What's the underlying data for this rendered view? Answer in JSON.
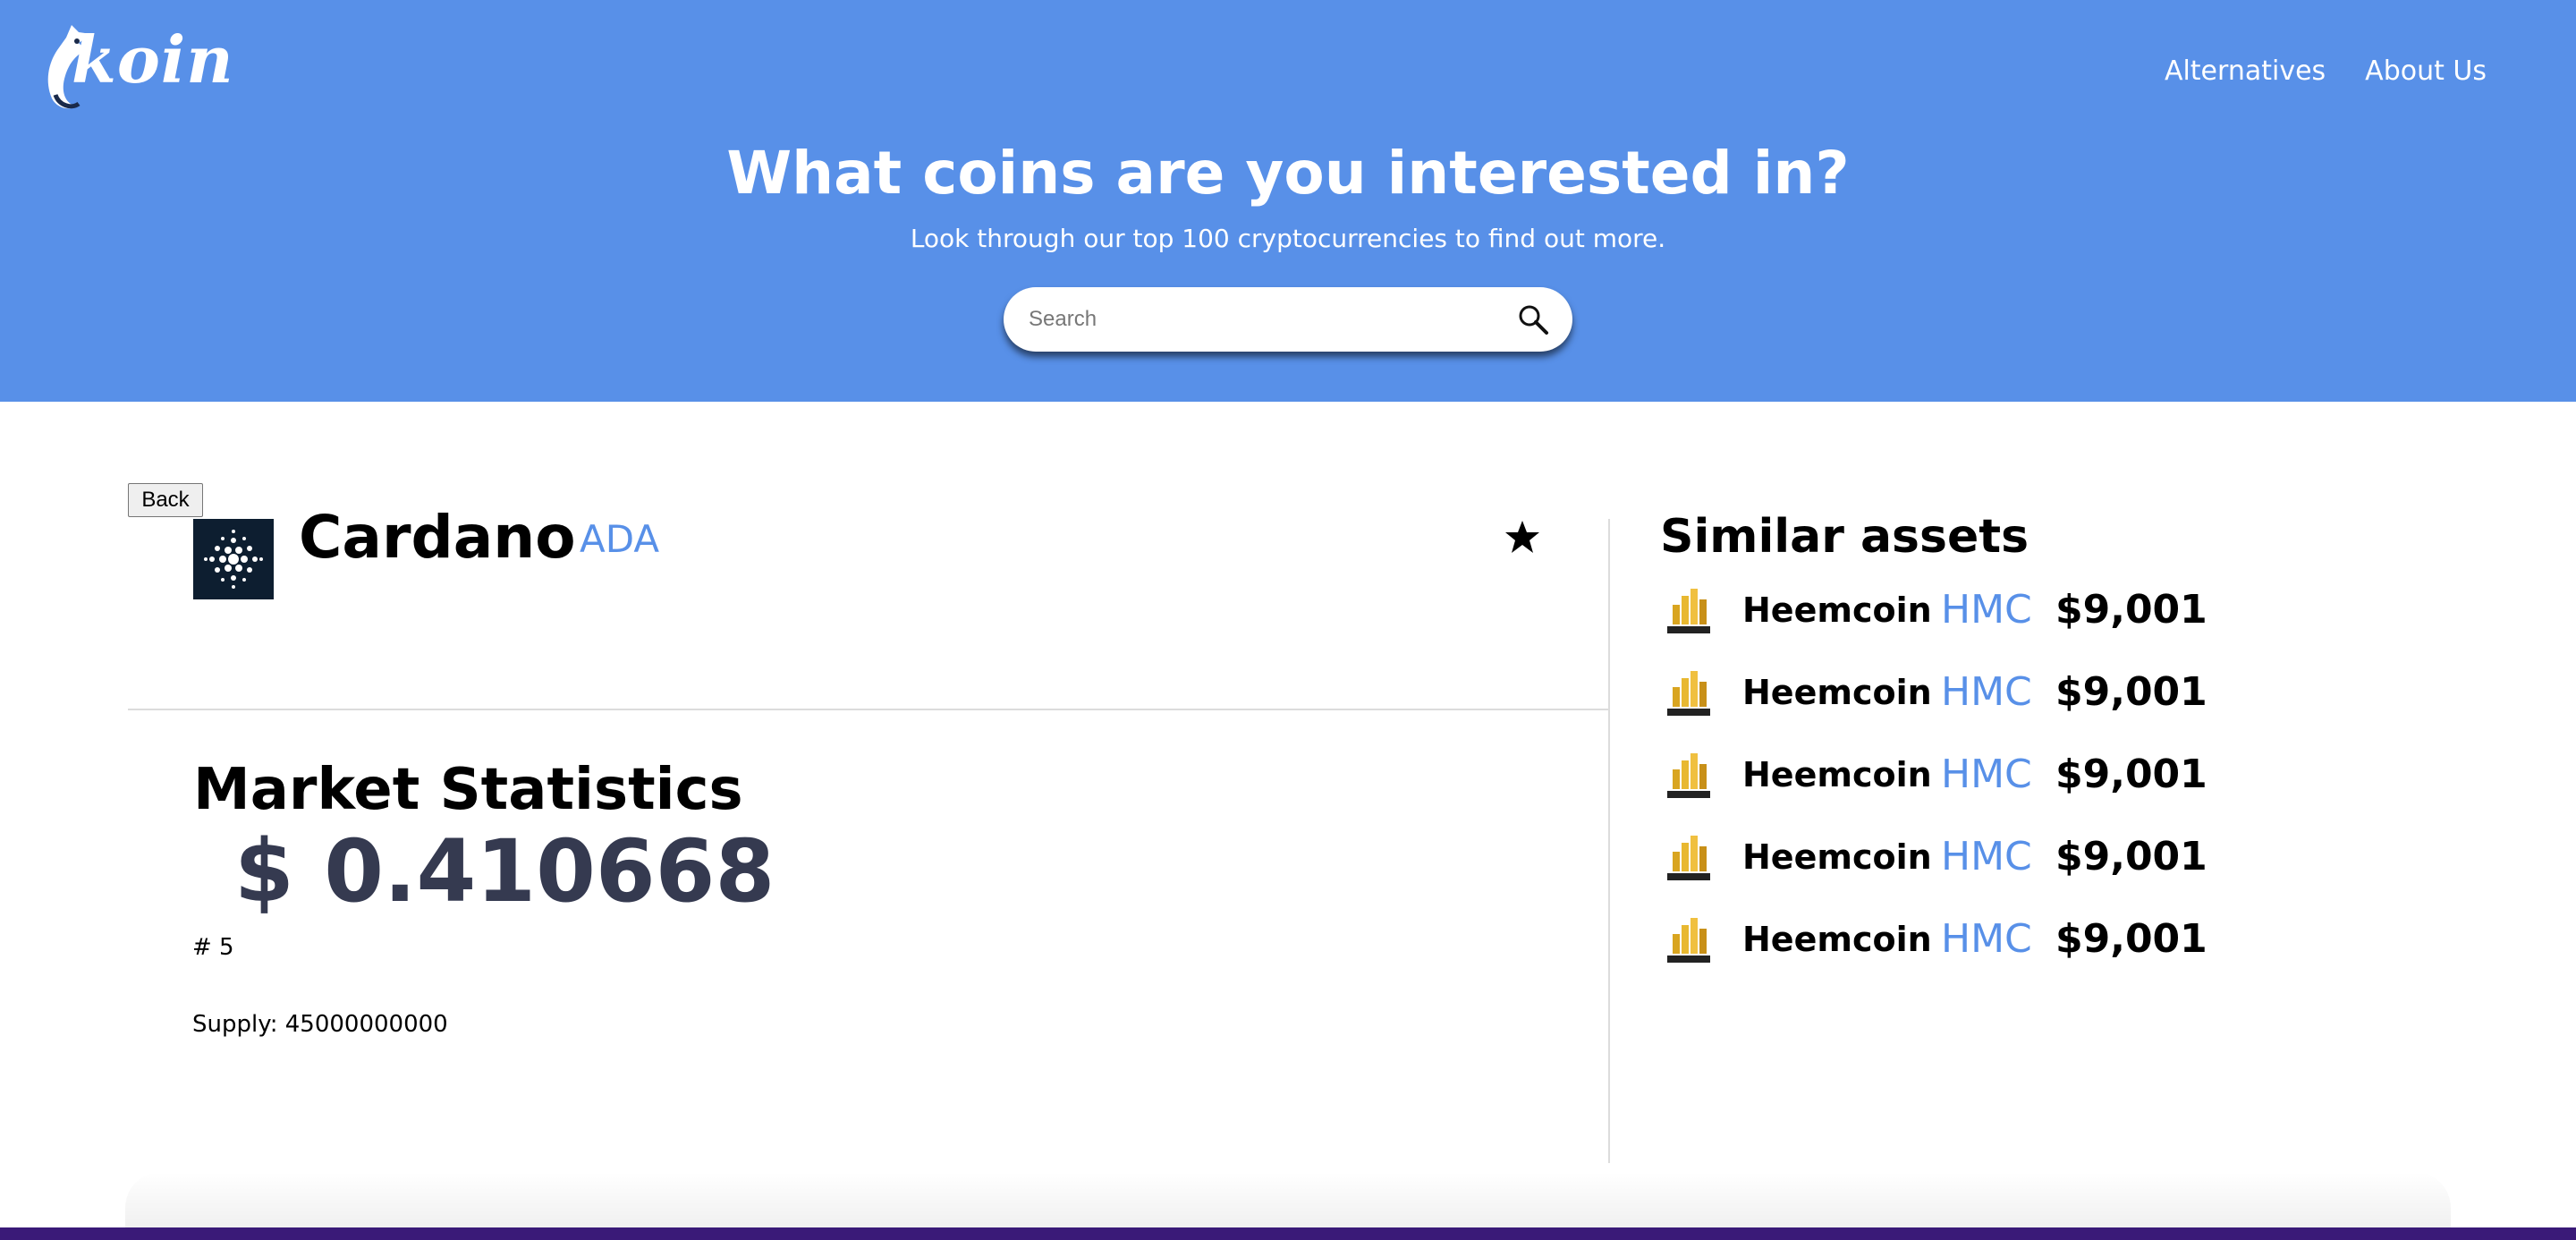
{
  "header": {
    "logo_text": "koin",
    "nav": [
      {
        "label": "Alternatives"
      },
      {
        "label": "About Us"
      }
    ],
    "title": "What coins are you interested in?",
    "subtitle": "Look through our top 100 cryptocurrencies to find out more.",
    "search": {
      "placeholder": "Search",
      "value": ""
    }
  },
  "coin": {
    "back_label": "Back",
    "name": "Cardano",
    "symbol": "ADA",
    "logo_icon": "cardano-logo-icon",
    "favorite_icon": "star-icon"
  },
  "market": {
    "title": "Market Statistics",
    "price": "$ 0.410668",
    "rank": "# 5",
    "supply": "Supply: 45000000000"
  },
  "similar": {
    "title": "Similar assets",
    "items": [
      {
        "name": "Heemcoin",
        "symbol": "HMC",
        "price": "$9,001",
        "icon": "sixeleven-logo-icon"
      },
      {
        "name": "Heemcoin",
        "symbol": "HMC",
        "price": "$9,001",
        "icon": "sixeleven-logo-icon"
      },
      {
        "name": "Heemcoin",
        "symbol": "HMC",
        "price": "$9,001",
        "icon": "sixeleven-logo-icon"
      },
      {
        "name": "Heemcoin",
        "symbol": "HMC",
        "price": "$9,001",
        "icon": "sixeleven-logo-icon"
      },
      {
        "name": "Heemcoin",
        "symbol": "HMC",
        "price": "$9,001",
        "icon": "sixeleven-logo-icon"
      }
    ]
  },
  "colors": {
    "header_bg": "#5890e8",
    "accent": "#5890e8",
    "price_text": "#353a50",
    "footer_band": "#3a1a78"
  }
}
